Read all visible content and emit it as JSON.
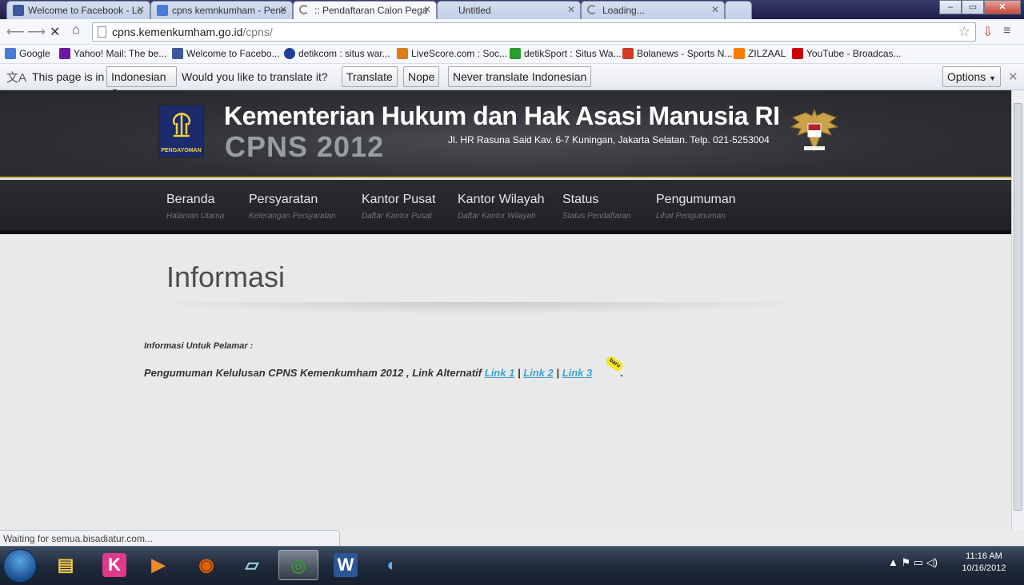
{
  "tabs": [
    {
      "label": "Welcome to Facebook - Lo",
      "icon": "facebook-icon",
      "color": "#3b5998"
    },
    {
      "label": "cpns kemnkumham - Pene",
      "icon": "google-icon",
      "color": "#4a7bd8"
    },
    {
      "label": ":: Pendaftaran Calon Pega",
      "icon": "loading-spinner-icon",
      "color": "#888888"
    },
    {
      "label": "Untitled",
      "icon": "blank-icon",
      "color": "#cccccc"
    },
    {
      "label": "Loading...",
      "icon": "loading-spinner-icon",
      "color": "#888888"
    }
  ],
  "window_controls": {
    "minimize": "–",
    "maximize": "▭",
    "close": "✕"
  },
  "url": {
    "host": "cpns.kemenkumham.go.id",
    "path": "/cpns/"
  },
  "bookmarks": [
    {
      "label": "Google",
      "icon": "google-icon",
      "color": "#4a7bd8"
    },
    {
      "label": "Yahoo! Mail: The be...",
      "icon": "yahoo-icon",
      "color": "#6b1aa3"
    },
    {
      "label": "Welcome to Facebo...",
      "icon": "facebook-icon",
      "color": "#3b5998"
    },
    {
      "label": "detikcom : situs war...",
      "icon": "detik-icon",
      "color": "#1f3f9a"
    },
    {
      "label": "LiveScore.com : Soc...",
      "icon": "livescore-icon",
      "color": "#e07b1a"
    },
    {
      "label": "detikSport : Situs Wa...",
      "icon": "detiksport-icon",
      "color": "#2b9b2b"
    },
    {
      "label": "Bolanews - Sports N...",
      "icon": "bolanews-icon",
      "color": "#d23b23"
    },
    {
      "label": "ZILZAAL",
      "icon": "blogger-icon",
      "color": "#f57d00"
    },
    {
      "label": "YouTube - Broadcas...",
      "icon": "youtube-icon",
      "color": "#cc0000"
    }
  ],
  "translate_bar": {
    "prefix": "This page is in",
    "language": "Indonesian",
    "question": "Would you like to translate it?",
    "translate": "Translate",
    "nope": "Nope",
    "never": "Never translate Indonesian",
    "options": "Options"
  },
  "site": {
    "logo_text": "PENGAYOMAN",
    "title": "Kementerian Hukum dan Hak Asasi Manusia RI",
    "subtitle": "CPNS 2012",
    "address": "Jl. HR Rasuna Said Kav. 6-7 Kuningan, Jakarta Selatan. Telp. 021-5253004",
    "nav": [
      {
        "label": "Beranda",
        "sub": "Halaman Utama"
      },
      {
        "label": "Persyaratan",
        "sub": "Keterangan Persyaratan"
      },
      {
        "label": "Kantor Pusat",
        "sub": "Daftar Kantor Pusat"
      },
      {
        "label": "Kantor Wilayah",
        "sub": "Daftar Kantor Wilayah"
      },
      {
        "label": "Status",
        "sub": "Status Pendaftaran"
      },
      {
        "label": "Pengumuman",
        "sub": "Lihat Pengumuman"
      }
    ],
    "page_title": "Informasi",
    "info_label": "Informasi Untuk Pelamar :",
    "announcement": "Pengumuman Kelulusan CPNS Kemenkumham 2012 , Link Alternatif",
    "links": [
      "Link 1",
      "Link 2",
      "Link 3"
    ],
    "separator": "|",
    "badge": "baru",
    "trailing": "."
  },
  "status_text": "Waiting for semua.bisadiatur.com...",
  "taskbar": {
    "apps": [
      {
        "icon": "windows-explorer-icon",
        "glyph": "▤",
        "color": "#f2c94c"
      },
      {
        "icon": "kingsoft-icon",
        "glyph": "K",
        "color": "#e0398a"
      },
      {
        "icon": "media-player-icon",
        "glyph": "▶",
        "color": "#f08a24"
      },
      {
        "icon": "firefox-icon",
        "glyph": "◉",
        "color": "#e66000"
      },
      {
        "icon": "notepad-icon",
        "glyph": "▱",
        "color": "#9fd3e6"
      },
      {
        "icon": "chrome-icon",
        "glyph": "◎",
        "color": "#3b8f3b"
      },
      {
        "icon": "word-icon",
        "glyph": "W",
        "color": "#2b5797"
      },
      {
        "icon": "messenger-icon",
        "glyph": "◐",
        "color": "#5fb3e8"
      }
    ],
    "tray": "▲  ⚑  ▭  ◁)",
    "time": "11:16 AM",
    "date": "10/16/2012"
  }
}
